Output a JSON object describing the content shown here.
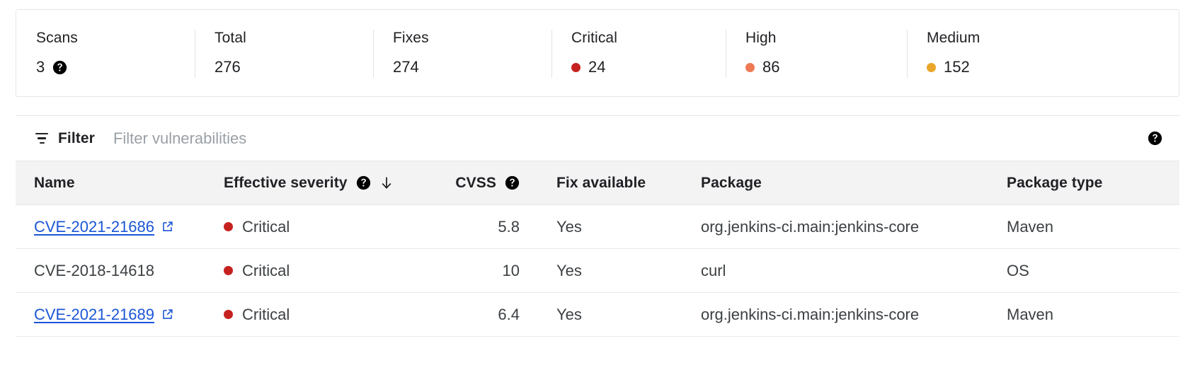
{
  "colors": {
    "critical": "#c5221f",
    "high": "#ef7954",
    "medium": "#eaa62a",
    "link": "#1a56d6",
    "header_bg": "#f3f3f4",
    "text": "#202124"
  },
  "stats": [
    {
      "label": "Scans",
      "value": "3",
      "has_help": true,
      "dot": null
    },
    {
      "label": "Total",
      "value": "276",
      "has_help": false,
      "dot": null
    },
    {
      "label": "Fixes",
      "value": "274",
      "has_help": false,
      "dot": null
    },
    {
      "label": "Critical",
      "value": "24",
      "has_help": false,
      "dot": "#c5221f"
    },
    {
      "label": "High",
      "value": "86",
      "has_help": false,
      "dot": "#ef7954"
    },
    {
      "label": "Medium",
      "value": "152",
      "has_help": false,
      "dot": "#eaa62a"
    }
  ],
  "filter": {
    "button_label": "Filter",
    "placeholder": "Filter vulnerabilities",
    "value": "",
    "help_icon": "help-icon",
    "icon": "filter-icon"
  },
  "table": {
    "columns": [
      {
        "label": "Name",
        "has_help": false,
        "sorted": false,
        "align": "left"
      },
      {
        "label": "Effective severity",
        "has_help": true,
        "sorted": true,
        "align": "left"
      },
      {
        "label": "CVSS",
        "has_help": true,
        "sorted": false,
        "align": "right"
      },
      {
        "label": "Fix available",
        "has_help": false,
        "sorted": false,
        "align": "left"
      },
      {
        "label": "Package",
        "has_help": false,
        "sorted": false,
        "align": "left"
      },
      {
        "label": "Package type",
        "has_help": false,
        "sorted": false,
        "align": "left"
      }
    ],
    "sort_direction": "descending",
    "rows": [
      {
        "name": "CVE-2021-21686",
        "is_link": true,
        "severity": "Critical",
        "severity_color": "#c5221f",
        "cvss": "5.8",
        "fix_available": "Yes",
        "package": "org.jenkins-ci.main:jenkins-core",
        "package_type": "Maven"
      },
      {
        "name": "CVE-2018-14618",
        "is_link": false,
        "severity": "Critical",
        "severity_color": "#c5221f",
        "cvss": "10",
        "fix_available": "Yes",
        "package": "curl",
        "package_type": "OS"
      },
      {
        "name": "CVE-2021-21689",
        "is_link": true,
        "severity": "Critical",
        "severity_color": "#c5221f",
        "cvss": "6.4",
        "fix_available": "Yes",
        "package": "org.jenkins-ci.main:jenkins-core",
        "package_type": "Maven"
      }
    ]
  }
}
